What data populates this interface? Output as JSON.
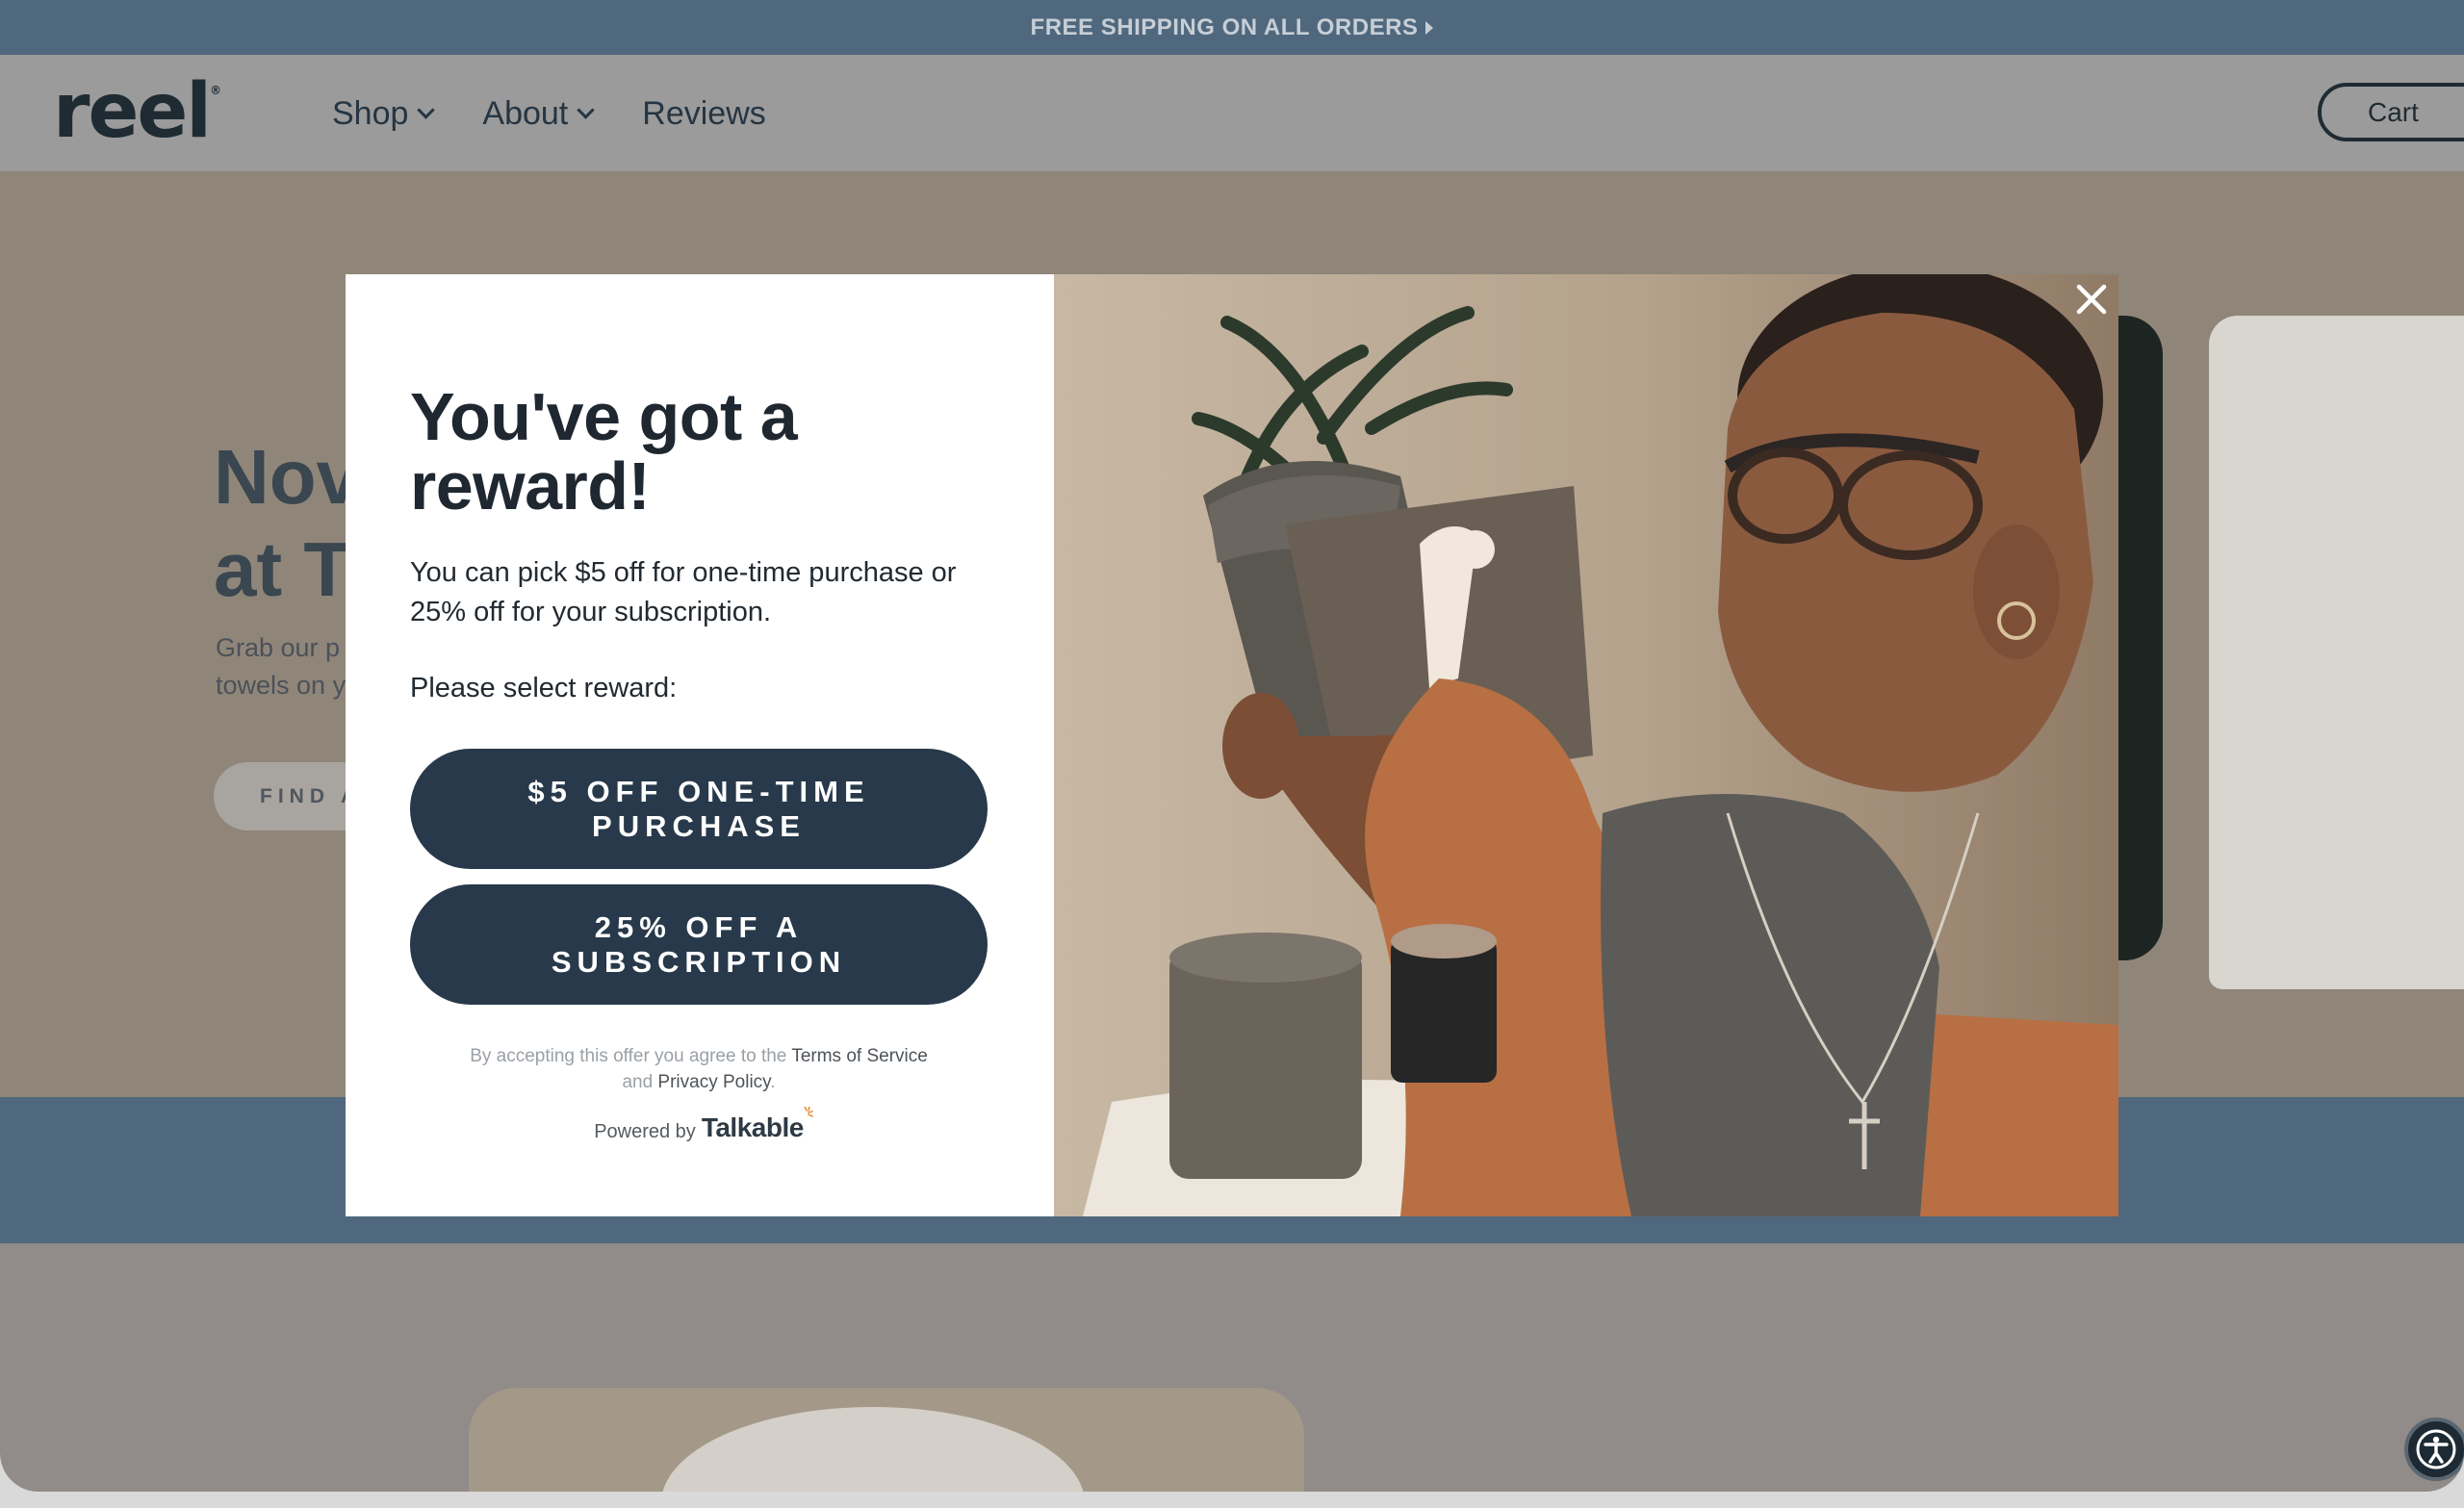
{
  "announcement": {
    "text": "FREE SHIPPING ON ALL ORDERS"
  },
  "header": {
    "logo": "reel",
    "nav": [
      {
        "label": "Shop"
      },
      {
        "label": "About"
      },
      {
        "label": "Reviews"
      }
    ],
    "cart_label": "Cart"
  },
  "hero": {
    "title_line1": "Nov",
    "title_line2": "at T",
    "subtitle_line1": "Grab our p",
    "subtitle_line2": "towels on y",
    "cta_label": "FIND A"
  },
  "modal": {
    "title": "You've got a reward!",
    "description": "You can pick $5 off for one-time purchase or 25% off for your subscription.",
    "prompt": "Please select reward:",
    "option_one_time": "$5 OFF ONE-TIME PURCHASE",
    "option_subscription": "25% OFF A SUBSCRIPTION",
    "legal_prefix": "By accepting this offer you agree to the",
    "terms_link": "Terms of Service",
    "legal_and": "and",
    "privacy_link": "Privacy Policy",
    "legal_suffix": ".",
    "powered_by": "Powered by",
    "brand": "Talkable"
  },
  "colors": {
    "announcement_bg": "#4f687d",
    "button_bg": "#27394a",
    "overlay_header": "#9b9b9b"
  },
  "icons": {
    "close": "close-icon",
    "accessibility": "accessibility-icon",
    "chevron": "chevron-down-icon"
  }
}
